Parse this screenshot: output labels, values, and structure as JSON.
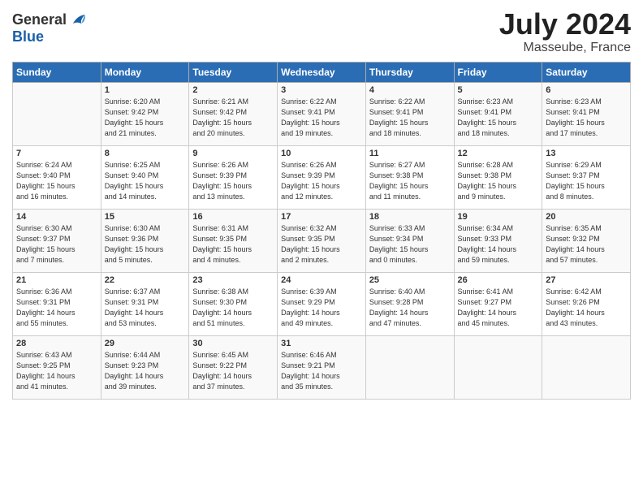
{
  "header": {
    "logo_general": "General",
    "logo_blue": "Blue",
    "month_year": "July 2024",
    "location": "Masseube, France"
  },
  "days_of_week": [
    "Sunday",
    "Monday",
    "Tuesday",
    "Wednesday",
    "Thursday",
    "Friday",
    "Saturday"
  ],
  "weeks": [
    [
      {
        "day": "",
        "info": ""
      },
      {
        "day": "1",
        "info": "Sunrise: 6:20 AM\nSunset: 9:42 PM\nDaylight: 15 hours\nand 21 minutes."
      },
      {
        "day": "2",
        "info": "Sunrise: 6:21 AM\nSunset: 9:42 PM\nDaylight: 15 hours\nand 20 minutes."
      },
      {
        "day": "3",
        "info": "Sunrise: 6:22 AM\nSunset: 9:41 PM\nDaylight: 15 hours\nand 19 minutes."
      },
      {
        "day": "4",
        "info": "Sunrise: 6:22 AM\nSunset: 9:41 PM\nDaylight: 15 hours\nand 18 minutes."
      },
      {
        "day": "5",
        "info": "Sunrise: 6:23 AM\nSunset: 9:41 PM\nDaylight: 15 hours\nand 18 minutes."
      },
      {
        "day": "6",
        "info": "Sunrise: 6:23 AM\nSunset: 9:41 PM\nDaylight: 15 hours\nand 17 minutes."
      }
    ],
    [
      {
        "day": "7",
        "info": "Sunrise: 6:24 AM\nSunset: 9:40 PM\nDaylight: 15 hours\nand 16 minutes."
      },
      {
        "day": "8",
        "info": "Sunrise: 6:25 AM\nSunset: 9:40 PM\nDaylight: 15 hours\nand 14 minutes."
      },
      {
        "day": "9",
        "info": "Sunrise: 6:26 AM\nSunset: 9:39 PM\nDaylight: 15 hours\nand 13 minutes."
      },
      {
        "day": "10",
        "info": "Sunrise: 6:26 AM\nSunset: 9:39 PM\nDaylight: 15 hours\nand 12 minutes."
      },
      {
        "day": "11",
        "info": "Sunrise: 6:27 AM\nSunset: 9:38 PM\nDaylight: 15 hours\nand 11 minutes."
      },
      {
        "day": "12",
        "info": "Sunrise: 6:28 AM\nSunset: 9:38 PM\nDaylight: 15 hours\nand 9 minutes."
      },
      {
        "day": "13",
        "info": "Sunrise: 6:29 AM\nSunset: 9:37 PM\nDaylight: 15 hours\nand 8 minutes."
      }
    ],
    [
      {
        "day": "14",
        "info": "Sunrise: 6:30 AM\nSunset: 9:37 PM\nDaylight: 15 hours\nand 7 minutes."
      },
      {
        "day": "15",
        "info": "Sunrise: 6:30 AM\nSunset: 9:36 PM\nDaylight: 15 hours\nand 5 minutes."
      },
      {
        "day": "16",
        "info": "Sunrise: 6:31 AM\nSunset: 9:35 PM\nDaylight: 15 hours\nand 4 minutes."
      },
      {
        "day": "17",
        "info": "Sunrise: 6:32 AM\nSunset: 9:35 PM\nDaylight: 15 hours\nand 2 minutes."
      },
      {
        "day": "18",
        "info": "Sunrise: 6:33 AM\nSunset: 9:34 PM\nDaylight: 15 hours\nand 0 minutes."
      },
      {
        "day": "19",
        "info": "Sunrise: 6:34 AM\nSunset: 9:33 PM\nDaylight: 14 hours\nand 59 minutes."
      },
      {
        "day": "20",
        "info": "Sunrise: 6:35 AM\nSunset: 9:32 PM\nDaylight: 14 hours\nand 57 minutes."
      }
    ],
    [
      {
        "day": "21",
        "info": "Sunrise: 6:36 AM\nSunset: 9:31 PM\nDaylight: 14 hours\nand 55 minutes."
      },
      {
        "day": "22",
        "info": "Sunrise: 6:37 AM\nSunset: 9:31 PM\nDaylight: 14 hours\nand 53 minutes."
      },
      {
        "day": "23",
        "info": "Sunrise: 6:38 AM\nSunset: 9:30 PM\nDaylight: 14 hours\nand 51 minutes."
      },
      {
        "day": "24",
        "info": "Sunrise: 6:39 AM\nSunset: 9:29 PM\nDaylight: 14 hours\nand 49 minutes."
      },
      {
        "day": "25",
        "info": "Sunrise: 6:40 AM\nSunset: 9:28 PM\nDaylight: 14 hours\nand 47 minutes."
      },
      {
        "day": "26",
        "info": "Sunrise: 6:41 AM\nSunset: 9:27 PM\nDaylight: 14 hours\nand 45 minutes."
      },
      {
        "day": "27",
        "info": "Sunrise: 6:42 AM\nSunset: 9:26 PM\nDaylight: 14 hours\nand 43 minutes."
      }
    ],
    [
      {
        "day": "28",
        "info": "Sunrise: 6:43 AM\nSunset: 9:25 PM\nDaylight: 14 hours\nand 41 minutes."
      },
      {
        "day": "29",
        "info": "Sunrise: 6:44 AM\nSunset: 9:23 PM\nDaylight: 14 hours\nand 39 minutes."
      },
      {
        "day": "30",
        "info": "Sunrise: 6:45 AM\nSunset: 9:22 PM\nDaylight: 14 hours\nand 37 minutes."
      },
      {
        "day": "31",
        "info": "Sunrise: 6:46 AM\nSunset: 9:21 PM\nDaylight: 14 hours\nand 35 minutes."
      },
      {
        "day": "",
        "info": ""
      },
      {
        "day": "",
        "info": ""
      },
      {
        "day": "",
        "info": ""
      }
    ]
  ]
}
